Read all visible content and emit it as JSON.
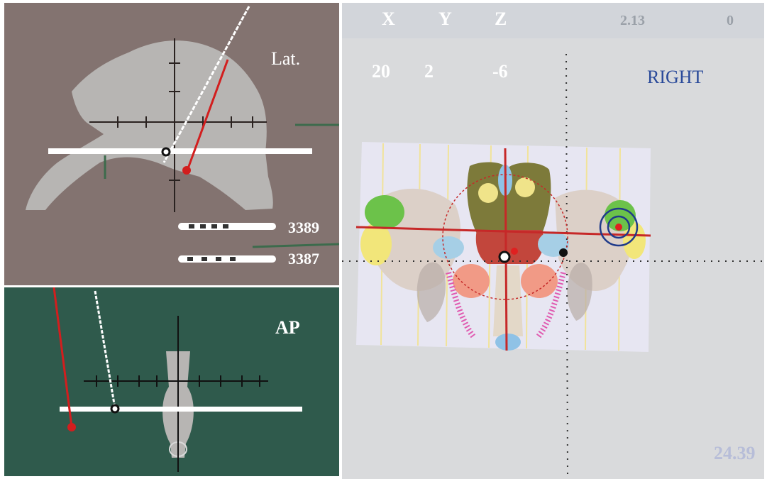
{
  "lateral_view": {
    "label": "Lat."
  },
  "ap_view": {
    "label": "AP"
  },
  "electrodes": [
    {
      "model": "3389"
    },
    {
      "model": "3387"
    }
  ],
  "coordinates": {
    "axes": [
      "X",
      "Y",
      "Z"
    ],
    "values": [
      "20",
      "2",
      "-6"
    ]
  },
  "readouts": {
    "top_left": "2.13",
    "top_right": "0",
    "bottom_right": "24.39"
  },
  "atlas": {
    "side_label": "RIGHT"
  },
  "colors": {
    "lateral_bg": "#837370",
    "ap_bg": "#2f5a4c",
    "atlas_bg": "#d9dadc",
    "trajectory_red": "#d21e1e",
    "trajectory_white": "#ffffff",
    "crosshair_red": "#c62828",
    "target_blue": "#1f3a8a",
    "label_blue": "#2a4a9a"
  }
}
